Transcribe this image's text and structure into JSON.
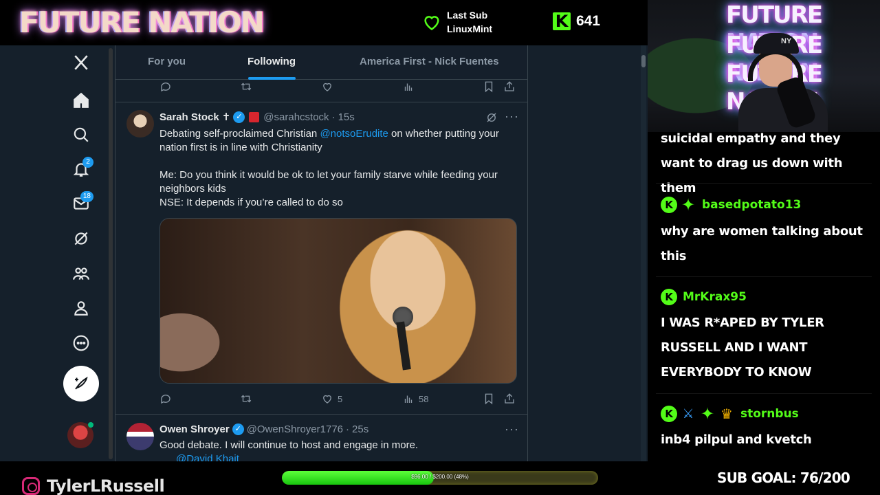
{
  "overlay": {
    "brand": "FUTURE NATION",
    "last_sub_label": "Last Sub",
    "last_sub_name": "LinuxMint",
    "viewer_count": "641",
    "kick_logo": "K",
    "neon_lines": [
      "FUTURE NATION",
      "FUTURE NATION",
      "FUTURE NATION"
    ],
    "cap_logo": "NY"
  },
  "x_app": {
    "logo": "X",
    "nav": [
      {
        "icon": "home-icon"
      },
      {
        "icon": "search-icon"
      },
      {
        "icon": "notifications-icon",
        "badge": "2"
      },
      {
        "icon": "messages-icon",
        "badge": "18"
      },
      {
        "icon": "grok-icon"
      },
      {
        "icon": "communities-icon"
      },
      {
        "icon": "profile-icon"
      },
      {
        "icon": "more-icon"
      }
    ],
    "tabs": [
      {
        "label": "For you",
        "active": false
      },
      {
        "label": "Following",
        "active": true
      },
      {
        "label": "America First - Nick Fuentes",
        "active": false
      }
    ],
    "tweets": [
      {
        "name": "Sarah Stock",
        "cross": "✝",
        "handle": "@sarahcstock",
        "time": "15s",
        "text_before_mention": "Debating self-proclaimed Christian ",
        "mention": "@notsoErudite",
        "text_after_mention": " on whether putting your nation first is in line with Christianity",
        "paragraph_2": "Me: Do you think it would be ok to let your family starve while feeding your neighbors kids",
        "paragraph_3": "NSE: It depends if you’re called to do so",
        "likes": "5",
        "views": "58"
      },
      {
        "name": "Owen Shroyer",
        "handle": "@OwenShroyer1776",
        "time": "25s",
        "text": "Good debate. I will continue to host and engage in more.",
        "mention": "@David Khait"
      }
    ],
    "more_glyph": "···",
    "dot": "·"
  },
  "chat": {
    "messages": [
      {
        "text": "suicidal empathy and they want to drag us down with them"
      },
      {
        "user": "basedpotato13",
        "text": "why are women talking about this"
      },
      {
        "user": "MrKrax95",
        "text": "I WAS R*APED BY TYLER RUSSELL AND I WANT EVERYBODY TO KNOW"
      },
      {
        "user": "stornbus",
        "text": "inb4 pilpul and kvetch"
      }
    ],
    "colors": {
      "username": "#53fc18",
      "text": "#ffffff"
    }
  },
  "bottom": {
    "instagram_handle": "TylerLRussell",
    "goal_label": "$96.00 / $200.00 (48%)",
    "goal_progress": 0.48,
    "sub_goal": "SUB GOAL: 76/200"
  },
  "colors": {
    "accent": "#1d9bf0",
    "kick_green": "#53fc18",
    "bg": "#15202b"
  }
}
